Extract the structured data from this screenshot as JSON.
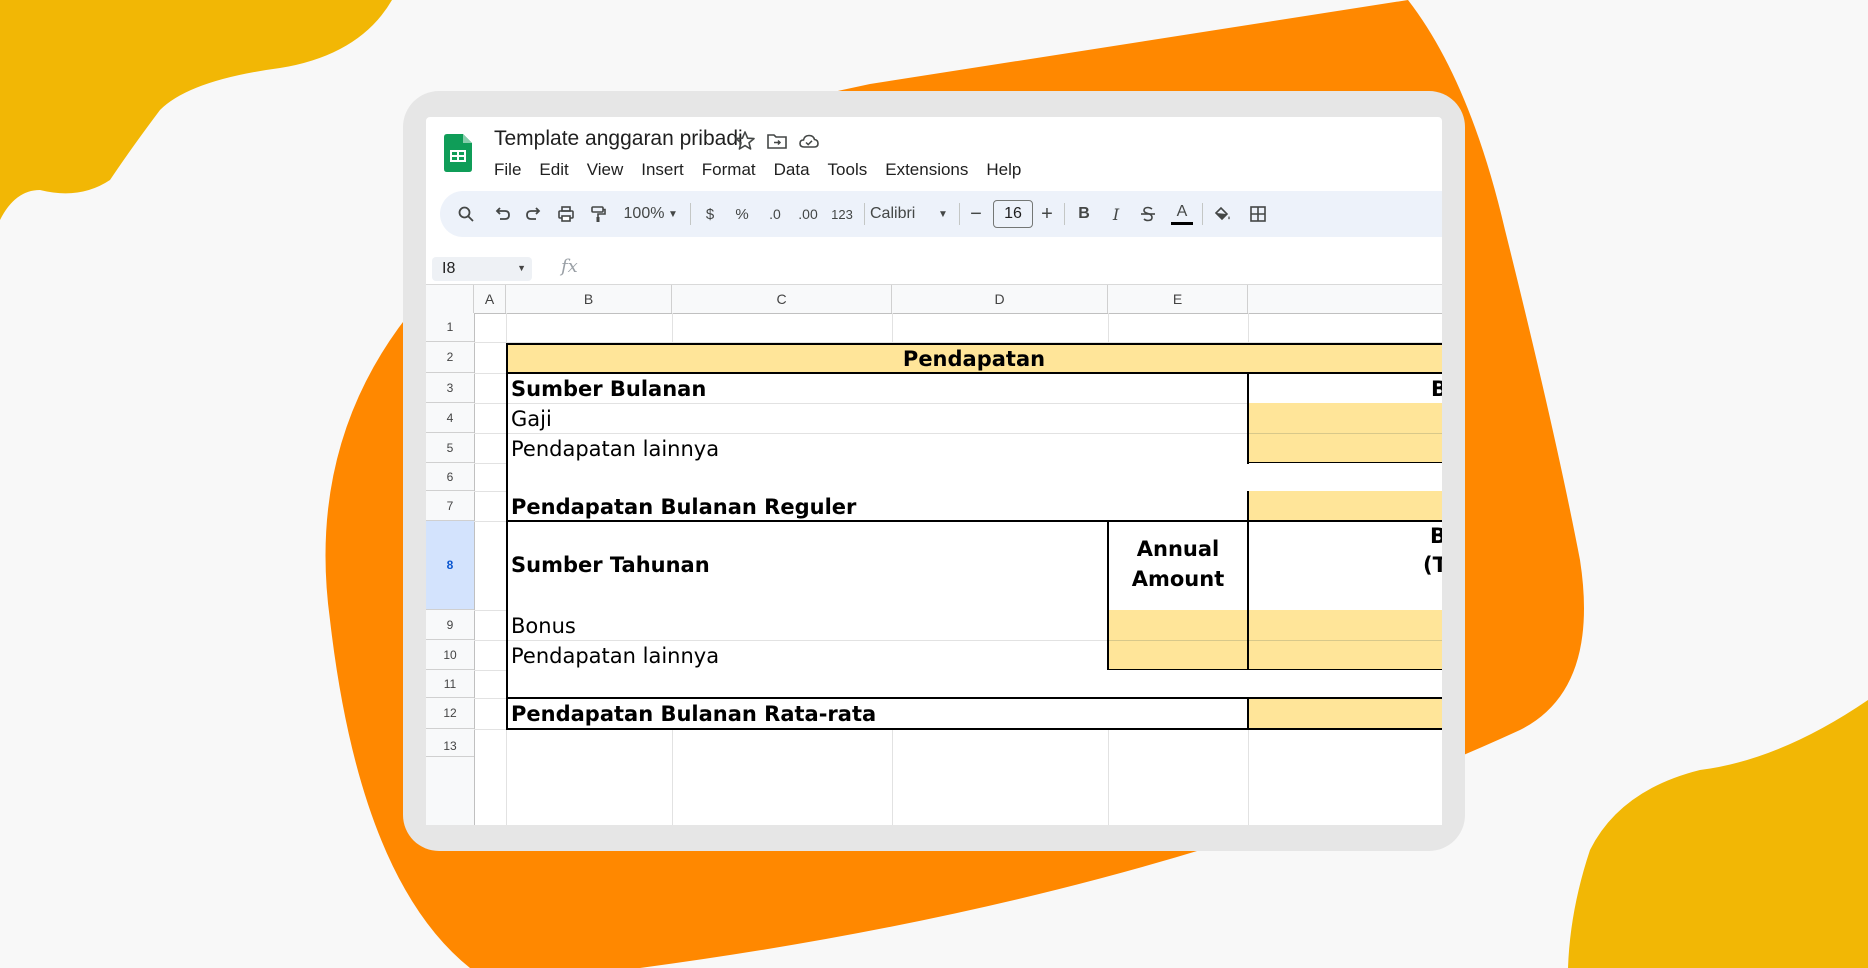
{
  "app": {
    "title": "Template anggaran pribadi",
    "icons": [
      "star-icon",
      "move-to-folder-icon",
      "cloud-status-icon"
    ]
  },
  "menu": [
    "File",
    "Edit",
    "View",
    "Insert",
    "Format",
    "Data",
    "Tools",
    "Extensions",
    "Help"
  ],
  "toolbar": {
    "zoom": "100%",
    "currency": "$",
    "percent": "%",
    "decrease_decimal": ".0",
    "increase_decimal": ".00",
    "number_format": "123",
    "font": "Calibri",
    "font_size": "16",
    "bold": "B",
    "italic": "I",
    "text_color": "A"
  },
  "formula_bar": {
    "cell_ref": "I8",
    "fx": "fx"
  },
  "columns": [
    "A",
    "B",
    "C",
    "D",
    "E"
  ],
  "rows": [
    "1",
    "2",
    "3",
    "4",
    "5",
    "6",
    "7",
    "8",
    "9",
    "10",
    "11",
    "12",
    "13"
  ],
  "selected_row": "8",
  "sheet": {
    "header": "Pendapatan",
    "monthly_sources": "Sumber Bulanan",
    "monthly_col_partial": "B",
    "salary": "Gaji",
    "other_income_1": "Pendapatan lainnya",
    "regular_monthly": "Pendapatan Bulanan Reguler",
    "annual_sources": "Sumber Tahunan",
    "annual_amount_line1": "Annual",
    "annual_amount_line2": "Amount",
    "annual_col_partial_line1": "B",
    "annual_col_partial_line2": "(T",
    "bonus": "Bonus",
    "other_income_2": "Pendapatan lainnya",
    "average_monthly": "Pendapatan Bulanan Rata-rata"
  },
  "colors": {
    "accent_orange": "#ff8800",
    "accent_yellow": "#f2b705",
    "cell_yellow": "#ffe599",
    "sheets_green": "#0f9d58"
  }
}
